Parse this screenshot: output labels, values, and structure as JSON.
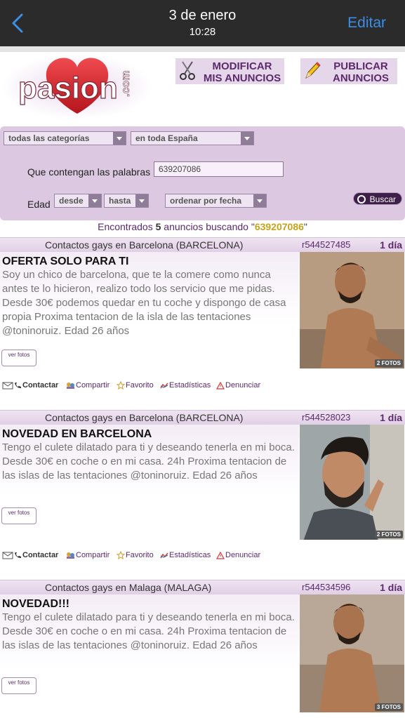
{
  "nav": {
    "title": "3 de enero",
    "time": "10:28",
    "edit_label": "Editar"
  },
  "header": {
    "logo_text": "pasion",
    "logo_suffix": ".com",
    "modify_label": "MODIFICAR\nMIS ANUNCIOS",
    "publish_label": "PUBLICAR\nANUNCIOS"
  },
  "search": {
    "category": "todas las categorías",
    "region": "en toda España",
    "keywords_label": "Que contengan las palabras",
    "keywords_value": "639207086",
    "age_label": "Edad",
    "age_from": "desde",
    "age_to": "hasta",
    "sort": "ordenar por fecha",
    "search_button": "Buscar"
  },
  "results": {
    "prefix": "Encontrados",
    "count": "5",
    "middle": "anuncios buscando \"",
    "query": "639207086",
    "suffix": "\""
  },
  "actions": {
    "contact": "Contactar",
    "share": "Compartir",
    "favorite": "Favorito",
    "stats": "Estadísticas",
    "report": "Denunciar"
  },
  "ads": [
    {
      "category": "Contactos gays en Barcelona (BARCELONA)",
      "ref": "r544527485",
      "age": "1 día",
      "title": "OFERTA SOLO PARA TI",
      "description": "Soy un chico de barcelona, que te la comere como nunca antes te lo hicieron, realizo todo los servicio que me pidas. Desde 30€ podemos quedar en tu coche y dispongo de casa propia Proxima tentacion de la isla de las tentaciones @toninoruiz. Edad 26 años",
      "photos": "2 FOTOS",
      "see_photos": "ver fotos"
    },
    {
      "category": "Contactos gays en Barcelona (BARCELONA)",
      "ref": "r544528023",
      "age": "1 día",
      "title": "NOVEDAD EN BARCELONA",
      "description": "Tengo el culete dilatado para ti y deseando tenerla en mi boca. Desde 30€ en coche o en mi casa. 24h Proxima tentacion de las islas de las tentaciones @toninoruiz. Edad 26 años",
      "photos": "2 FOTOS",
      "see_photos": "ver fotos"
    },
    {
      "category": "Contactos gays en Malaga (MALAGA)",
      "ref": "r544534596",
      "age": "1 día",
      "title": "NOVEDAD!!!",
      "description": "Tengo el culete dilatado para ti y deseando tenerla en mi boca. Desde 30€ en coche o en mi casa. 24h Proxima tentacion de las islas de las tentaciones @toninoruiz. Edad 26 años",
      "photos": "3 FOTOS",
      "see_photos": "ver fotos"
    }
  ],
  "colors": {
    "brand_purple": "#5b2a6b",
    "panel": "#dcc9e1",
    "ios_blue": "#3b8fe8",
    "heart_red": "#d6262e"
  }
}
